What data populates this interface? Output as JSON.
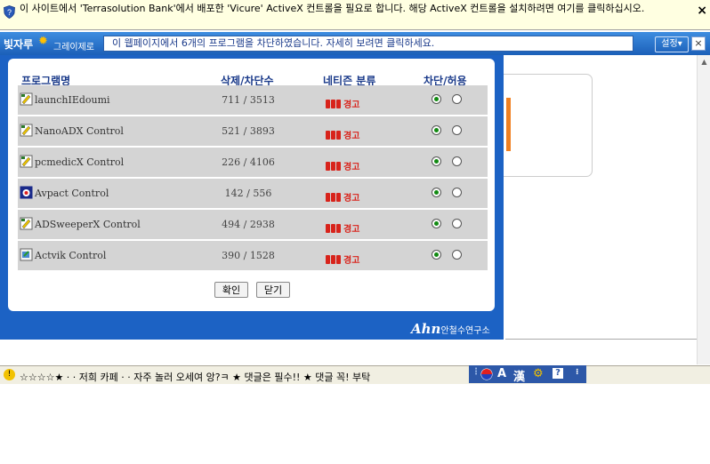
{
  "infobar": {
    "message": "이 사이트에서 'Terrasolution Bank'에서 배포한 'Vicure' ActiveX 컨트롤을 필요로 합니다. 해당 ActiveX 컨트롤을 설치하려면 여기를 클릭하십시오.",
    "close": "×"
  },
  "toolbar": {
    "logo_main": "빛자루",
    "logo_sub": "그레이제로",
    "notice": "이 웹페이지에서 6개의 프로그램을 차단하였습니다.   자세히 보려면 클릭하세요.",
    "settings_label": "설정",
    "close": "×"
  },
  "popup": {
    "headers": {
      "name": "프로그램명",
      "count": "삭제/차단수",
      "category": "네티즌 분류",
      "block": "차단/허용"
    },
    "rows": [
      {
        "name": "launchIEdoumi",
        "count": "711 / 3513",
        "category": "경고",
        "icon": "activex-script-icon"
      },
      {
        "name": "NanoADX Control",
        "count": "521 / 3893",
        "category": "경고",
        "icon": "activex-script-icon"
      },
      {
        "name": "pcmedicX Control",
        "count": "226 / 4106",
        "category": "경고",
        "icon": "activex-script-icon"
      },
      {
        "name": "Avpact Control",
        "count": "142 / 556",
        "category": "경고",
        "icon": "app-window-icon"
      },
      {
        "name": "ADSweeperX Control",
        "count": "494 / 2938",
        "category": "경고",
        "icon": "activex-script-icon"
      },
      {
        "name": "Actvik Control",
        "count": "390 / 1528",
        "category": "경고",
        "icon": "installer-icon"
      }
    ],
    "confirm_label": "확인",
    "close_label": "닫기",
    "brand_logo": "Ahn",
    "brand_name": "안철수연구소"
  },
  "statusbar": {
    "text": "☆☆☆☆★ · · 저희 카페 · · 자주 놀러 오세여 앙?ㅋ ★ 댓글은 필수!! ★ 댓글 꼭! 부탁",
    "ime_mode": "A",
    "ime_hanja": "漢"
  },
  "colors": {
    "toolbar_blue": "#1c62c4",
    "warning_red": "#d8231b",
    "radio_green": "#118a11"
  }
}
